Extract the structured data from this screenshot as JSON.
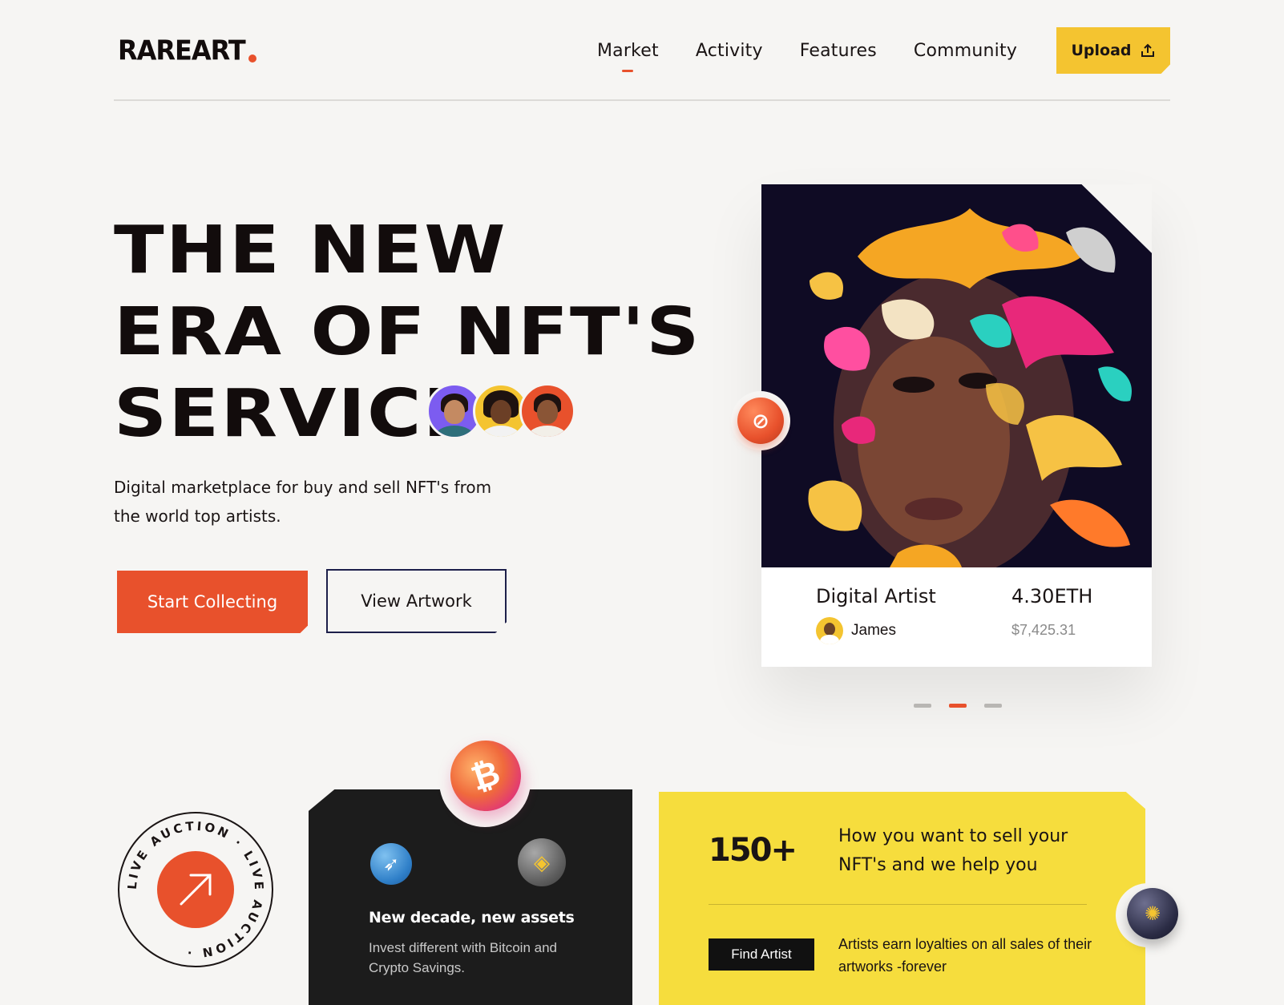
{
  "brand": {
    "logo": "RAREART",
    "accent": "#e8512c",
    "yellow": "#f4c430"
  },
  "nav": {
    "items": [
      {
        "label": "Market",
        "active": true
      },
      {
        "label": "Activity",
        "active": false
      },
      {
        "label": "Features",
        "active": false
      },
      {
        "label": "Community",
        "active": false
      }
    ],
    "upload_label": "Upload",
    "upload_icon": "upload-icon"
  },
  "hero": {
    "title_lines": [
      "THE NEW",
      "ERA OF NFT'S",
      "SERVICE"
    ],
    "subtitle": "Digital marketplace for buy and sell NFT's from the world top artists.",
    "primary_cta": "Start Collecting",
    "secondary_cta": "View Artwork"
  },
  "featured": {
    "title": "Digital Artist",
    "author": "James",
    "price_eth": "4.30ETH",
    "price_usd": "$7,425.31",
    "badge_icon": "currency-coin-icon",
    "carousel": {
      "count": 3,
      "active_index": 1
    }
  },
  "auction": {
    "ring_text": "LIVE AUCTION · LIVE AUCTION · ",
    "icon": "arrow-up-right-icon"
  },
  "promo": {
    "title": "New decade, new assets",
    "subtitle": "Invest different with Bitcoin and Crypto Savings.",
    "coin_icons": [
      "bitcoin-icon",
      "compass-coin-icon",
      "binance-coin-icon"
    ]
  },
  "stats": {
    "value": "150+",
    "heading": "How you want to sell your NFT's and we help you",
    "button": "Find Artist",
    "note": "Artists earn loyalties on all  sales of their artworks -forever",
    "coin_icon": "cardano-coin-icon"
  }
}
